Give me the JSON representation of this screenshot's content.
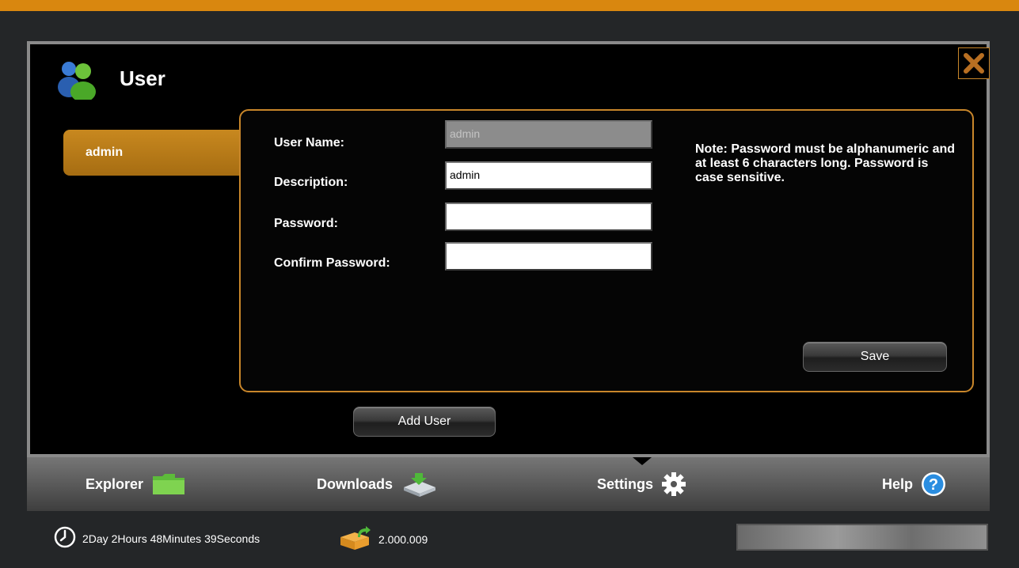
{
  "dialog": {
    "title": "User",
    "users": [
      {
        "name": "admin",
        "selected": true
      }
    ],
    "form": {
      "username": {
        "label": "User Name:",
        "value": "admin",
        "disabled": true
      },
      "description": {
        "label": "Description:",
        "value": "admin"
      },
      "password": {
        "label": "Password:",
        "value": ""
      },
      "confirm_password": {
        "label": "Confirm Password:",
        "value": ""
      }
    },
    "note": "Note: Password must be alphanumeric and at least 6 characters long. Password is case sensitive.",
    "save_label": "Save",
    "add_user_label": "Add User"
  },
  "nav": [
    {
      "label": "Explorer",
      "icon": "folder-icon"
    },
    {
      "label": "Downloads",
      "icon": "downloads-icon"
    },
    {
      "label": "Settings",
      "icon": "gear-icon",
      "active": true
    },
    {
      "label": "Help",
      "icon": "help-icon"
    }
  ],
  "status": {
    "uptime": "2Day 2Hours 48Minutes 39Seconds",
    "version": "2.000.009",
    "progress_fraction": 1.0
  },
  "colors": {
    "accent": "#d9870f",
    "panel_border": "#c8862a",
    "help_blue": "#2a8de0",
    "folder_green": "#5dbb3a"
  }
}
